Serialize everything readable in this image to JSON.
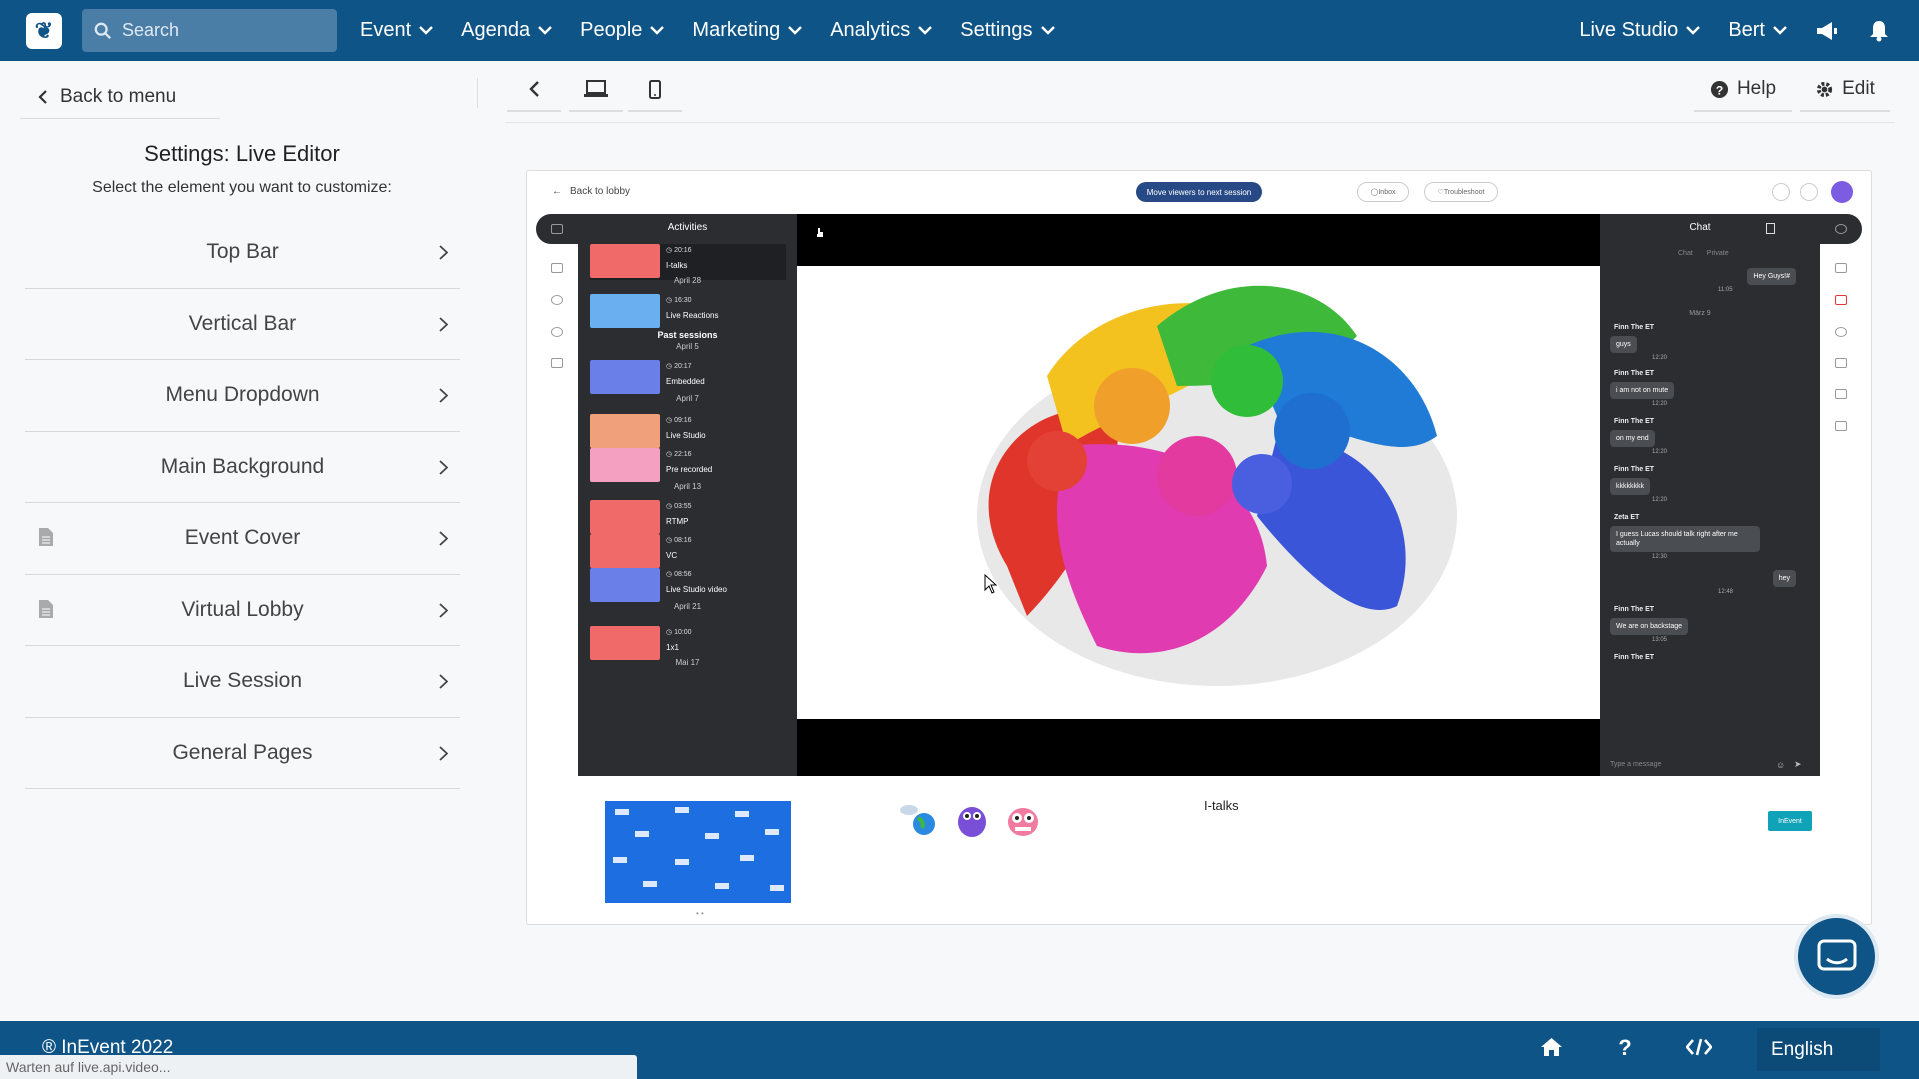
{
  "topbar": {
    "search_placeholder": "Search",
    "nav": [
      "Event",
      "Agenda",
      "People",
      "Marketing",
      "Analytics",
      "Settings"
    ],
    "right_nav": [
      "Live Studio",
      "Bert"
    ]
  },
  "sidebar": {
    "back_label": "Back to menu",
    "title": "Settings: Live Editor",
    "subtitle": "Select the element you want to customize:",
    "items": [
      {
        "label": "Top Bar",
        "icon": ""
      },
      {
        "label": "Vertical Bar",
        "icon": ""
      },
      {
        "label": "Menu Dropdown",
        "icon": ""
      },
      {
        "label": "Main Background",
        "icon": ""
      },
      {
        "label": "Event Cover",
        "icon": "document-icon"
      },
      {
        "label": "Virtual Lobby",
        "icon": "document-icon"
      },
      {
        "label": "Live Session",
        "icon": ""
      },
      {
        "label": "General Pages",
        "icon": ""
      }
    ]
  },
  "toolbar": {
    "help_label": "Help",
    "edit_label": "Edit"
  },
  "preview": {
    "back_lobby": "Back to lobby",
    "move_viewers": "Move viewers to next session",
    "inbox": "Inbox",
    "troubleshoot": "Troubleshoot",
    "activities_title": "Activities",
    "activities": [
      {
        "time": "20:16",
        "name": "I-talks",
        "color": "#f06a6a"
      },
      {
        "date": "April 28"
      },
      {
        "time": "16:30",
        "name": "Live Reactions",
        "color": "#6ab0f0"
      },
      {
        "section": "Past sessions"
      },
      {
        "date": "April 5"
      },
      {
        "time": "20:17",
        "name": "Embedded",
        "color": "#6a7fe8"
      },
      {
        "date": "April 7"
      },
      {
        "time": "09:16",
        "name": "Live Studio",
        "color": "#f0a07a"
      },
      {
        "time": "22:16",
        "name": "Pre recorded",
        "color": "#f4a0c0"
      },
      {
        "date": "April 13"
      },
      {
        "time": "03:55",
        "name": "RTMP",
        "color": "#f06a6a"
      },
      {
        "time": "08:16",
        "name": "VC",
        "color": "#f06a6a"
      },
      {
        "time": "08:56",
        "name": "Live Studio video",
        "color": "#6a7fe8"
      },
      {
        "date": "April 21"
      },
      {
        "time": "10:00",
        "name": "1x1",
        "color": "#f06a6a"
      },
      {
        "date": "Mai 17"
      }
    ],
    "chat": {
      "title": "Chat",
      "tab_chat": "Chat",
      "tab_private": "Private",
      "date_sep": "März 9",
      "messages": [
        {
          "name": "",
          "text": "Hey Guys!#",
          "time": "11:05",
          "own": true
        },
        {
          "name": "Finn The ET",
          "text": "guys",
          "time": "12:20"
        },
        {
          "name": "Finn The ET",
          "text": "i am not on mute",
          "time": "12:20"
        },
        {
          "name": "Finn The ET",
          "text": "on my end",
          "time": "12:20"
        },
        {
          "name": "Finn The ET",
          "text": "kkkkkkkk",
          "time": "12:20"
        },
        {
          "name": "Zeta ET",
          "text": "I guess Lucas should talk right after me actually",
          "time": "12:30"
        },
        {
          "name": "",
          "text": "hey",
          "time": "12:48",
          "own": true
        },
        {
          "name": "Finn The ET",
          "text": "We are on backstage",
          "time": "13:05"
        },
        {
          "name": "Finn The ET",
          "text": "",
          "time": ""
        }
      ],
      "input_placeholder": "Type a message"
    },
    "bottom_label": "I-talks",
    "logo_text": "InEvent"
  },
  "footer": {
    "copyright": "® InEvent 2022",
    "status": "Warten auf live.api.video...",
    "language": "English"
  }
}
